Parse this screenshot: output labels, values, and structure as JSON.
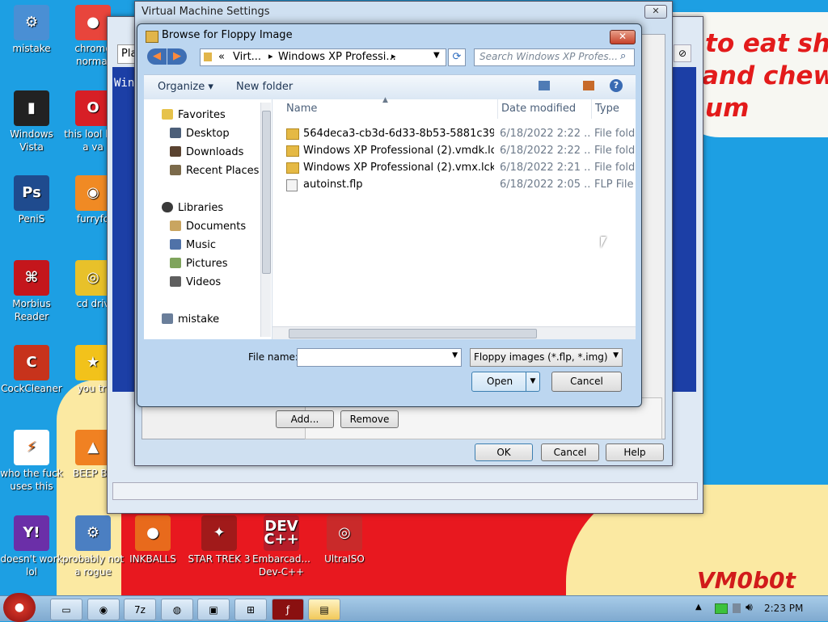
{
  "desktop": {
    "icons": [
      {
        "label": "mistake",
        "color": "#4a8fd4",
        "glyph": "⚙"
      },
      {
        "label": "chrome normal",
        "color": "#e8453c",
        "glyph": "●"
      },
      {
        "label": "Windows Vista",
        "color": "#222222",
        "glyph": "▮"
      },
      {
        "label": "this lool like a va",
        "color": "#d71f26",
        "glyph": "O"
      },
      {
        "label": "PeniS",
        "color": "#1f4b8e",
        "glyph": "Ps"
      },
      {
        "label": "furryfo",
        "color": "#f08a24",
        "glyph": "◉"
      },
      {
        "label": "Morbius Reader",
        "color": "#c4161c",
        "glyph": "⌘"
      },
      {
        "label": "cd driv",
        "color": "#e8c12a",
        "glyph": "◎"
      },
      {
        "label": "CockCleaner",
        "color": "#c7331c",
        "glyph": "C"
      },
      {
        "label": "you tri",
        "color": "#f2c21b",
        "glyph": "★"
      },
      {
        "label": "who the fuck uses this",
        "color": "#ffffff",
        "glyph": "⚡"
      },
      {
        "label": "BEEP BE",
        "color": "#f08122",
        "glyph": "▲"
      },
      {
        "label": "doesn't work lol",
        "color": "#6b2fa8",
        "glyph": "Y!"
      },
      {
        "label": "probably not a rogue",
        "color": "#4b7fc2",
        "glyph": "⚙"
      },
      {
        "label": "INKBALLS",
        "color": "#e86a1c",
        "glyph": "●"
      },
      {
        "label": "STAR TREK 3",
        "color": "#a11a1a",
        "glyph": "✦"
      },
      {
        "label": "Embarcad... Dev-C++",
        "color": "#b51d2a",
        "glyph": "DEV C++"
      },
      {
        "label": "UltraISO",
        "color": "#c92a2a",
        "glyph": "◎"
      }
    ],
    "meme_line1": "to eat shit",
    "meme_line2": "and chew",
    "meme_line3": "um",
    "watermark": "VM0b0t"
  },
  "vm_settings": {
    "title": "Virtual Machine Settings",
    "close_label": "✕",
    "add_label": "Add...",
    "remove_label": "Remove",
    "ok_label": "OK",
    "cancel_label": "Cancel",
    "help_label": "Help"
  },
  "bg_window": {
    "tab_fragment": "Pla",
    "text_fragment": "Win"
  },
  "dialog": {
    "title": "Browse for Floppy Image",
    "close_label": "✕",
    "address": {
      "prefix": "«",
      "crumb1": "Virt...",
      "crumb2": "Windows XP Professi...",
      "arrow": "▸"
    },
    "search_placeholder": "Search Windows XP Profes...",
    "organize_label": "Organize ▾",
    "new_folder_label": "New folder",
    "nav": {
      "favorites": "Favorites",
      "desktop": "Desktop",
      "downloads": "Downloads",
      "recent": "Recent Places",
      "libraries": "Libraries",
      "documents": "Documents",
      "music": "Music",
      "pictures": "Pictures",
      "videos": "Videos",
      "mistake": "mistake"
    },
    "columns": {
      "name": "Name",
      "date": "Date modified",
      "type": "Type"
    },
    "files": [
      {
        "name": "564deca3-cb3d-6d33-8b53-5881c39...",
        "date": "6/18/2022 2:22 ...",
        "type": "File folde"
      },
      {
        "name": "Windows XP Professional (2).vmdk.lck",
        "date": "6/18/2022 2:22 ...",
        "type": "File folde"
      },
      {
        "name": "Windows XP Professional (2).vmx.lck",
        "date": "6/18/2022 2:21 ...",
        "type": "File folde"
      },
      {
        "name": "autoinst.flp",
        "date": "6/18/2022 2:05 ...",
        "type": "FLP File"
      }
    ],
    "filename_label": "File name:",
    "filename_value": "",
    "filter_value": "Floppy images (*.flp, *.img)",
    "open_label": "Open",
    "cancel_label": "Cancel"
  },
  "taskbar": {
    "clock": "2:23 PM",
    "items": [
      "folder-icon",
      "chrome-icon",
      "7zip-icon",
      "firefox-icon",
      "vmware-icon",
      "network-icon",
      "flash-icon",
      "explorer-icon"
    ]
  }
}
